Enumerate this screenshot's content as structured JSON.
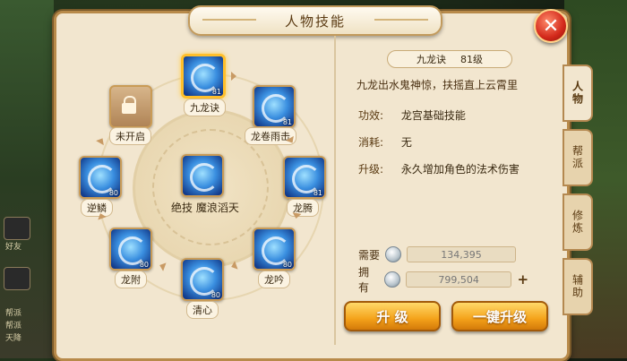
{
  "window": {
    "title": "人物技能",
    "close_icon": "close-icon"
  },
  "tabs": [
    {
      "label": "人物",
      "active": true
    },
    {
      "label": "帮派",
      "active": false
    },
    {
      "label": "修炼",
      "active": false
    },
    {
      "label": "辅助",
      "active": false
    }
  ],
  "wheel": {
    "center": {
      "label": "绝技 魔浪滔天"
    },
    "skills": [
      {
        "label": "九龙诀",
        "level": "81",
        "selected": true
      },
      {
        "label": "龙卷雨击",
        "level": "81"
      },
      {
        "label": "龙腾",
        "level": "81"
      },
      {
        "label": "龙吟",
        "level": "80"
      },
      {
        "label": "清心",
        "level": "80"
      },
      {
        "label": "龙附",
        "level": "80"
      },
      {
        "label": "逆鳞",
        "level": "80"
      },
      {
        "label": "未开启",
        "locked": true
      }
    ]
  },
  "detail": {
    "name": "九龙诀",
    "level": "81级",
    "description": "九龙出水鬼神惊，扶摇直上云霄里",
    "rows": [
      {
        "label": "功效:",
        "value": "龙宫基础技能"
      },
      {
        "label": "消耗:",
        "value": "无"
      },
      {
        "label": "升级:",
        "value": "永久增加角色的法术伤害"
      }
    ]
  },
  "cost": {
    "need_label": "需要",
    "need_value": "134,395",
    "have_label": "拥有",
    "have_value": "799,504",
    "plus": "+"
  },
  "buttons": {
    "upgrade": "升 级",
    "upgrade_all": "一键升级"
  },
  "left_chat": {
    "line1": "帮派",
    "line2": "帮派",
    "line3": "天降",
    "small": "好友"
  },
  "colors": {
    "panel": "#f2e6cf",
    "border": "#b88a4a",
    "button": "#f4a21a",
    "close": "#d2281a"
  }
}
